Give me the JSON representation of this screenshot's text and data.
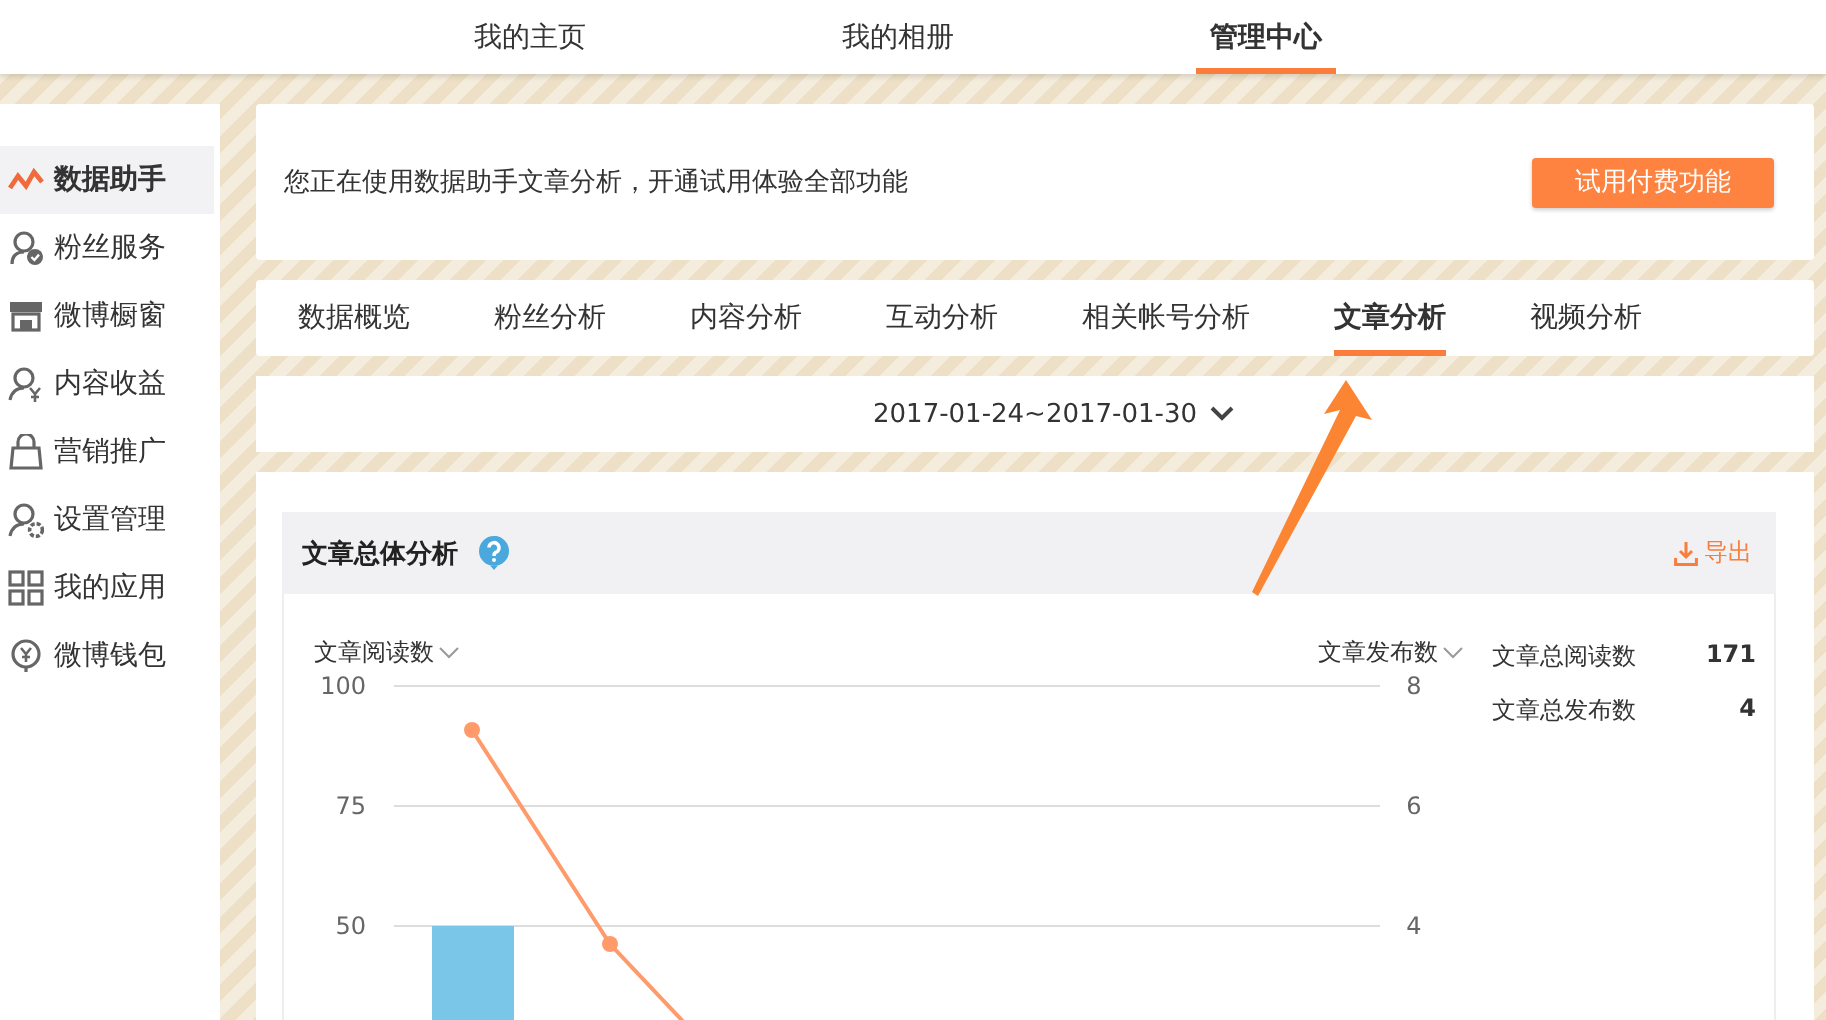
{
  "top_nav": {
    "tabs": [
      {
        "label": "我的主页",
        "selected": false
      },
      {
        "label": "我的相册",
        "selected": false
      },
      {
        "label": "管理中心",
        "selected": true
      }
    ]
  },
  "sidebar": {
    "items": [
      {
        "label": "数据助手",
        "kind": "chart",
        "selected": true
      },
      {
        "label": "粉丝服务",
        "kind": "fans",
        "selected": false
      },
      {
        "label": "微博橱窗",
        "kind": "shop",
        "selected": false
      },
      {
        "label": "内容收益",
        "kind": "income",
        "selected": false
      },
      {
        "label": "营销推广",
        "kind": "promo",
        "selected": false
      },
      {
        "label": "设置管理",
        "kind": "settings",
        "selected": false
      },
      {
        "label": "我的应用",
        "kind": "apps",
        "selected": false
      },
      {
        "label": "微博钱包",
        "kind": "wallet",
        "selected": false
      }
    ]
  },
  "notice": {
    "text": "您正在使用数据助手文章分析，开通试用体验全部功能",
    "button": "试用付费功能"
  },
  "tabs": [
    {
      "label": "数据概览",
      "selected": false
    },
    {
      "label": "粉丝分析",
      "selected": false
    },
    {
      "label": "内容分析",
      "selected": false
    },
    {
      "label": "互动分析",
      "selected": false
    },
    {
      "label": "相关帐号分析",
      "selected": false
    },
    {
      "label": "文章分析",
      "selected": true
    },
    {
      "label": "视频分析",
      "selected": false
    }
  ],
  "date_range": {
    "value": "2017-01-24~2017-01-30"
  },
  "analysis": {
    "title": "文章总体分析",
    "export": "导出",
    "chart": {
      "left_ticks": [
        "100",
        "75",
        "50"
      ],
      "right_ticks": [
        "8",
        "6",
        "4"
      ],
      "series": [
        {
          "name": "文章阅读数",
          "kind": "bar",
          "color": "#7ac6e8"
        },
        {
          "name": "文章发布数",
          "kind": "line",
          "color": "#ff9a6a"
        }
      ]
    },
    "stats": [
      {
        "label": "文章总阅读数",
        "value": "171"
      },
      {
        "label": "文章总发布数",
        "value": "4"
      }
    ]
  }
}
